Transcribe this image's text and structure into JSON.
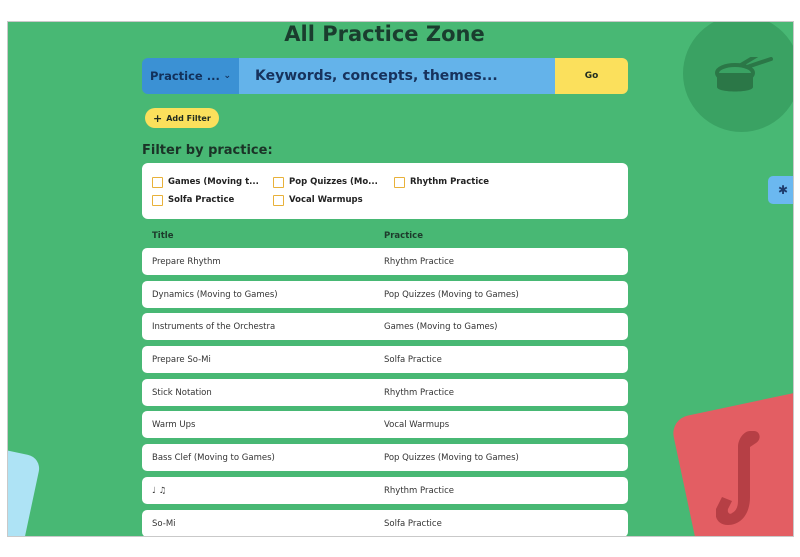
{
  "page": {
    "title": "All Practice Zone"
  },
  "search": {
    "select_label": "Practice ...",
    "keyword_placeholder": "Keywords, concepts, themes...",
    "go_label": "Go"
  },
  "add_filter": {
    "label": "Add Filter"
  },
  "filters": {
    "heading": "Filter by practice:",
    "options": [
      "Games (Moving t...",
      "Pop Quizzes (Mo...",
      "Rhythm Practice",
      "Solfa Practice",
      "Vocal Warmups"
    ]
  },
  "table": {
    "headers": [
      "Title",
      "Practice"
    ],
    "rows": [
      [
        "Prepare Rhythm",
        "Rhythm Practice"
      ],
      [
        "Dynamics (Moving to Games)",
        "Pop Quizzes (Moving to Games)"
      ],
      [
        "Instruments of the Orchestra",
        "Games (Moving to Games)"
      ],
      [
        "Prepare So-Mi",
        "Solfa Practice"
      ],
      [
        "Stick Notation",
        "Rhythm Practice"
      ],
      [
        "Warm Ups",
        "Vocal Warmups"
      ],
      [
        "Bass Clef (Moving to Games)",
        "Pop Quizzes (Moving to Games)"
      ],
      [
        "♩ ♫",
        "Rhythm Practice"
      ],
      [
        "So-Mi",
        "Solfa Practice"
      ]
    ]
  },
  "colors": {
    "background": "#48b874",
    "accent_yellow": "#fbe05c",
    "accent_blue": "#64b3ea",
    "accent_red": "#e35e63"
  },
  "icons": {
    "drum": "drum-icon",
    "saxophone": "saxophone-icon",
    "side_tab": "bug-icon"
  }
}
